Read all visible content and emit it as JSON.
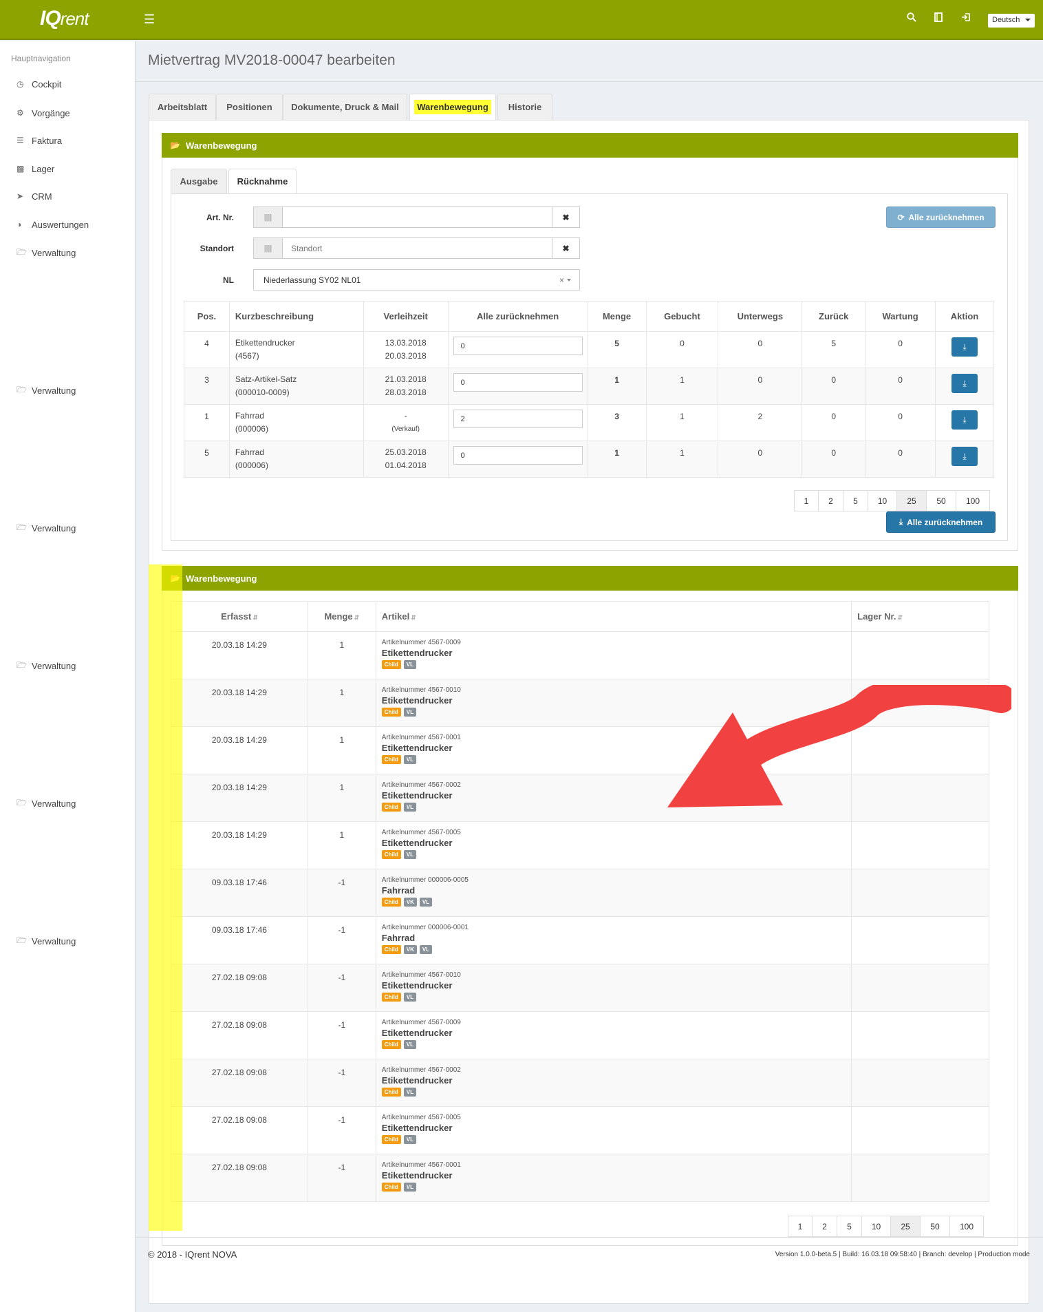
{
  "app": {
    "logo_main": "IQ",
    "logo_sub": "rent",
    "language": "Deutsch"
  },
  "sidebar": {
    "heading": "Hauptnavigation",
    "items": [
      {
        "label": "Cockpit",
        "icon": "dashboard-icon"
      },
      {
        "label": "Vorgänge",
        "icon": "gears-icon"
      },
      {
        "label": "Faktura",
        "icon": "layers-icon"
      },
      {
        "label": "Lager",
        "icon": "cubes-icon"
      },
      {
        "label": "CRM",
        "icon": "send-icon"
      },
      {
        "label": "Auswertungen",
        "icon": "pie-chart-icon"
      },
      {
        "label": "Verwaltung",
        "icon": "folder-icon"
      },
      {
        "label": "Verwaltung",
        "icon": "folder-icon"
      },
      {
        "label": "Verwaltung",
        "icon": "folder-icon"
      },
      {
        "label": "Verwaltung",
        "icon": "folder-icon"
      },
      {
        "label": "Verwaltung",
        "icon": "folder-icon"
      },
      {
        "label": "Verwaltung",
        "icon": "folder-icon"
      }
    ]
  },
  "page": {
    "title": "Mietvertrag MV2018-00047 bearbeiten"
  },
  "tabs": [
    "Arbeitsblatt",
    "Positionen",
    "Dokumente, Druck & Mail",
    "Warenbewegung",
    "Historie"
  ],
  "box1": {
    "title": "Warenbewegung",
    "subtabs": [
      "Ausgabe",
      "Rücknahme"
    ],
    "fields": {
      "art_label": "Art. Nr.",
      "standort_label": "Standort",
      "standort_placeholder": "Standort",
      "nl_label": "NL",
      "nl_value": "Niederlassung SY02 NL01"
    },
    "btn_all_top": "Alle zurücknehmen",
    "btn_all_bottom": "Alle zurücknehmen",
    "table": {
      "headers": [
        "Pos.",
        "Kurzbeschreibung",
        "Verleihzeit",
        "Alle zurücknehmen",
        "Menge",
        "Gebucht",
        "Unterwegs",
        "Zurück",
        "Wartung",
        "Aktion"
      ],
      "rows": [
        {
          "pos": "4",
          "desc1": "Etikettendrucker",
          "desc2": "(4567)",
          "time1": "13.03.2018",
          "time2": "20.03.2018",
          "input": "0",
          "menge": "5",
          "gebucht": "0",
          "unterwegs": "0",
          "zurueck": "5",
          "wartung": "0"
        },
        {
          "pos": "3",
          "desc1": "Satz-Artikel-Satz",
          "desc2": "(000010-0009)",
          "time1": "21.03.2018",
          "time2": "28.03.2018",
          "input": "0",
          "menge": "1",
          "gebucht": "1",
          "unterwegs": "0",
          "zurueck": "0",
          "wartung": "0"
        },
        {
          "pos": "1",
          "desc1": "Fahrrad",
          "desc2": "(000006)",
          "time1": "-",
          "time2": "(Verkauf)",
          "input": "2",
          "menge": "3",
          "gebucht": "1",
          "unterwegs": "2",
          "zurueck": "0",
          "wartung": "0"
        },
        {
          "pos": "5",
          "desc1": "Fahrrad",
          "desc2": "(000006)",
          "time1": "25.03.2018",
          "time2": "01.04.2018",
          "input": "0",
          "menge": "1",
          "gebucht": "1",
          "unterwegs": "0",
          "zurueck": "0",
          "wartung": "0"
        }
      ]
    },
    "pager": [
      "1",
      "2",
      "5",
      "10",
      "25",
      "50",
      "100"
    ],
    "pager_active": "25"
  },
  "box2": {
    "title": "Warenbewegung",
    "headers": [
      "Erfasst",
      "Menge",
      "Artikel",
      "Lager Nr."
    ],
    "rows": [
      {
        "date": "20.03.18 14:29",
        "menge": "1",
        "artno": "Artikelnummer 4567-0009",
        "name": "Etikettendrucker",
        "badges": [
          "Child",
          "VL"
        ]
      },
      {
        "date": "20.03.18 14:29",
        "menge": "1",
        "artno": "Artikelnummer 4567-0010",
        "name": "Etikettendrucker",
        "badges": [
          "Child",
          "VL"
        ]
      },
      {
        "date": "20.03.18 14:29",
        "menge": "1",
        "artno": "Artikelnummer 4567-0001",
        "name": "Etikettendrucker",
        "badges": [
          "Child",
          "VL"
        ]
      },
      {
        "date": "20.03.18 14:29",
        "menge": "1",
        "artno": "Artikelnummer 4567-0002",
        "name": "Etikettendrucker",
        "badges": [
          "Child",
          "VL"
        ]
      },
      {
        "date": "20.03.18 14:29",
        "menge": "1",
        "artno": "Artikelnummer 4567-0005",
        "name": "Etikettendrucker",
        "badges": [
          "Child",
          "VL"
        ]
      },
      {
        "date": "09.03.18 17:46",
        "menge": "-1",
        "artno": "Artikelnummer 000006-0005",
        "name": "Fahrrad",
        "badges": [
          "Child",
          "VK",
          "VL"
        ]
      },
      {
        "date": "09.03.18 17:46",
        "menge": "-1",
        "artno": "Artikelnummer 000006-0001",
        "name": "Fahrrad",
        "badges": [
          "Child",
          "VK",
          "VL"
        ]
      },
      {
        "date": "27.02.18 09:08",
        "menge": "-1",
        "artno": "Artikelnummer 4567-0010",
        "name": "Etikettendrucker",
        "badges": [
          "Child",
          "VL"
        ]
      },
      {
        "date": "27.02.18 09:08",
        "menge": "-1",
        "artno": "Artikelnummer 4567-0009",
        "name": "Etikettendrucker",
        "badges": [
          "Child",
          "VL"
        ]
      },
      {
        "date": "27.02.18 09:08",
        "menge": "-1",
        "artno": "Artikelnummer 4567-0002",
        "name": "Etikettendrucker",
        "badges": [
          "Child",
          "VL"
        ]
      },
      {
        "date": "27.02.18 09:08",
        "menge": "-1",
        "artno": "Artikelnummer 4567-0005",
        "name": "Etikettendrucker",
        "badges": [
          "Child",
          "VL"
        ]
      },
      {
        "date": "27.02.18 09:08",
        "menge": "-1",
        "artno": "Artikelnummer 4567-0001",
        "name": "Etikettendrucker",
        "badges": [
          "Child",
          "VL"
        ]
      }
    ],
    "pager": [
      "1",
      "2",
      "5",
      "10",
      "25",
      "50",
      "100"
    ],
    "pager_active": "25"
  },
  "footer": {
    "left": "© 2018 - IQrent NOVA",
    "right": "Version 1.0.0-beta.5 | Build: 16.03.18 09:58:40 | Branch: develop | Production mode"
  },
  "colors": {
    "brand": "#8da400",
    "primary": "#2776a8",
    "highlight": "#ffff33",
    "arrow": "#f24141",
    "badge_child": "#f39c12"
  }
}
